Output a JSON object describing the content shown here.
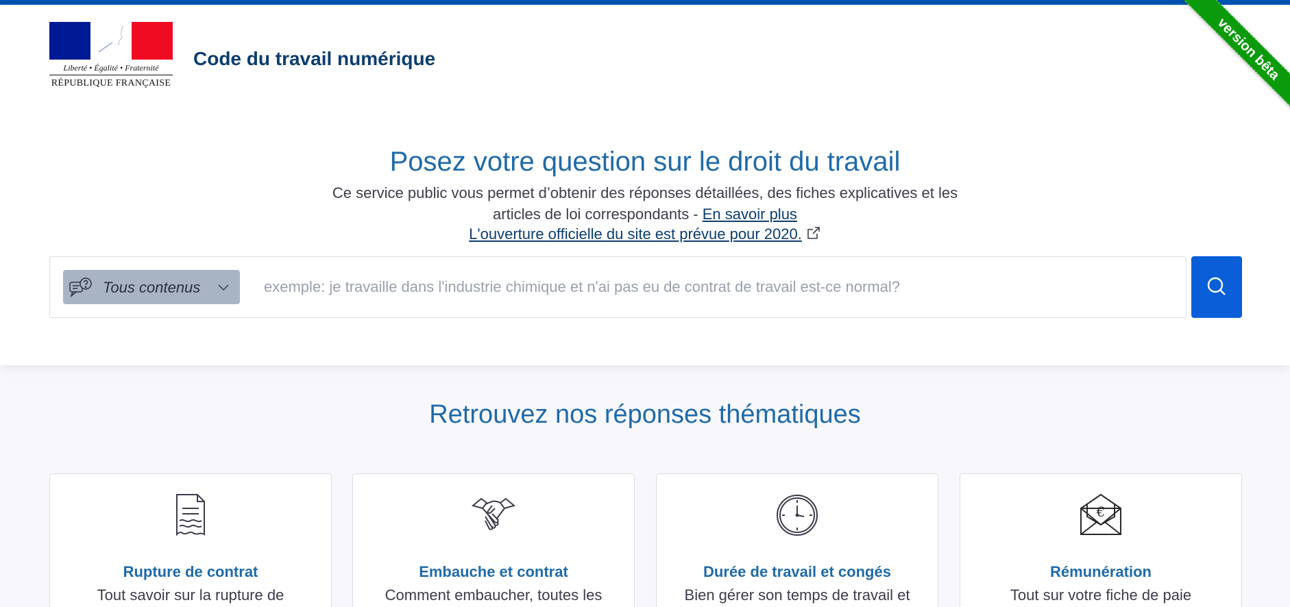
{
  "header": {
    "logo": {
      "motto": "Liberté • Égalité • Fraternité",
      "country": "RÉPUBLIQUE FRANÇAISE"
    },
    "site_title": "Code du travail numérique",
    "beta_label": "version bêta"
  },
  "hero": {
    "title": "Posez votre question sur le droit du travail",
    "description_part1": "Ce service public vous permet d’obtenir des réponses détaillées, des fiches explicatives et les articles de loi correspondants - ",
    "learn_more_link": "En savoir plus",
    "opening_link": "L'ouverture officielle du site est prévue pour 2020."
  },
  "search": {
    "filter_label": "Tous contenus",
    "placeholder": "exemple: je travaille dans l'industrie chimique et n'ai pas eu de contrat de travail est-ce normal?",
    "value": ""
  },
  "themes": {
    "title": "Retrouvez nos réponses thématiques",
    "cards": [
      {
        "title": "Rupture de contrat",
        "description": "Tout savoir sur la rupture de",
        "icon": "document-icon"
      },
      {
        "title": "Embauche et contrat",
        "description": "Comment embaucher, toutes les",
        "icon": "handshake-icon"
      },
      {
        "title": "Durée de travail et congés",
        "description": "Bien gérer son temps de travail et",
        "icon": "clock-icon"
      },
      {
        "title": "Rémunération",
        "description": "Tout sur votre fiche de paie",
        "icon": "euro-envelope-icon"
      }
    ]
  },
  "colors": {
    "accent": "#1f6aa8",
    "top_bar": "#0053b3",
    "search_button": "#0a5fd9",
    "beta_ribbon": "#0b9a0b",
    "filter_bg": "#a8b4c4"
  }
}
